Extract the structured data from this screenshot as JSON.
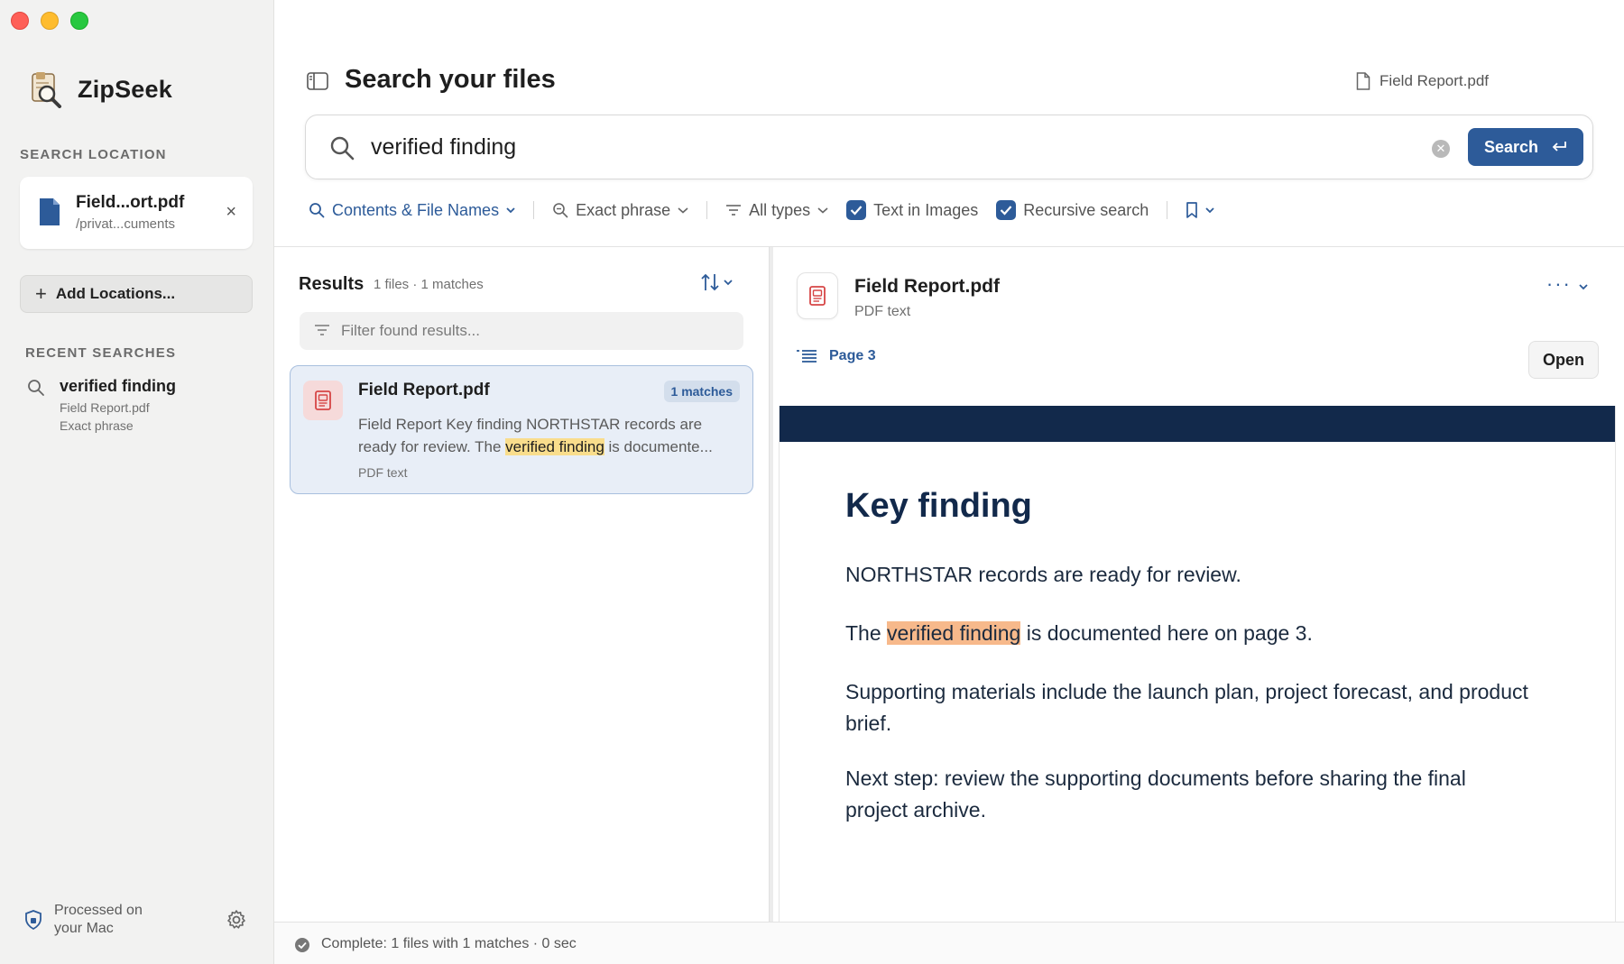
{
  "app": {
    "name": "ZipSeek"
  },
  "sidebar": {
    "search_location_label": "SEARCH LOCATION",
    "location": {
      "name": "Field...ort.pdf",
      "path": "/privat...cuments",
      "close_glyph": "×"
    },
    "add_locations_label": "Add Locations...",
    "recent_label": "RECENT SEARCHES",
    "recent": [
      {
        "query": "verified finding",
        "file": "Field Report.pdf",
        "mode": "Exact phrase"
      }
    ],
    "privacy_text": "Processed on your Mac"
  },
  "header": {
    "title": "Search your files",
    "current_file": "Field Report.pdf"
  },
  "search": {
    "value": "verified finding",
    "placeholder": "",
    "button_label": "Search"
  },
  "filters": {
    "scope": "Contents & File Names",
    "match_mode": "Exact phrase",
    "types": "All types",
    "text_in_images": {
      "label": "Text in Images",
      "checked": true
    },
    "recursive": {
      "label": "Recursive search",
      "checked": true
    }
  },
  "results": {
    "title": "Results",
    "count": "1 files · 1 matches",
    "filter_placeholder": "Filter found results...",
    "items": [
      {
        "name": "Field Report.pdf",
        "badge": "1 matches",
        "snippet_pre": "Field Report Key finding NORTHSTAR records are ready for review. The ",
        "snippet_match": "verified finding",
        "snippet_post": " is documente...",
        "type": "PDF text"
      }
    ]
  },
  "preview": {
    "name": "Field Report.pdf",
    "type": "PDF text",
    "page_label": "Page 3",
    "open_label": "Open",
    "more_glyph": "···",
    "doc": {
      "heading": "Key finding",
      "p1": "NORTHSTAR records are ready for review.",
      "p2_pre": "The ",
      "p2_match": "verified finding",
      "p2_post": " is documented here on page 3.",
      "p3": "Supporting materials include the launch plan, project forecast, and product brief.",
      "p4": "Next step: review the supporting documents before sharing the final project archive."
    }
  },
  "status": {
    "text": "Complete: 1 files with 1 matches · 0 sec"
  },
  "colors": {
    "accent": "#2d5b99",
    "sidebar_bg": "#f2f2f1",
    "highlight": "#f9dd8c",
    "doc_band": "#12294b",
    "pdf_red": "#d64545"
  }
}
